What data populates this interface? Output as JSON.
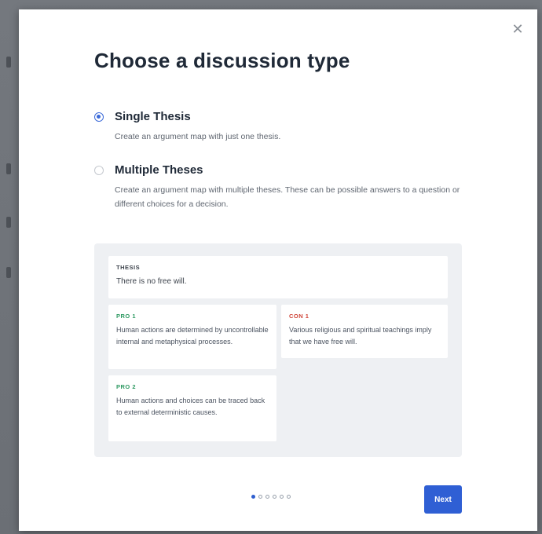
{
  "dialog": {
    "close_icon": "close-icon",
    "title": "Choose a discussion type"
  },
  "options": [
    {
      "label": "Single Thesis",
      "description": "Create an argument map with just one thesis.",
      "selected": true
    },
    {
      "label": "Multiple Theses",
      "description": "Create an argument map with multiple theses. These can be possible answers to a question or different choices for a decision.",
      "selected": false
    }
  ],
  "preview": {
    "thesis": {
      "tag": "THESIS",
      "text": "There is no free will."
    },
    "pro1": {
      "tag": "PRO 1",
      "text": "Human actions are determined by uncontrollable internal and metaphysical processes."
    },
    "con1": {
      "tag": "CON 1",
      "text": "Various religious and spiritual teachings imply that we have free will."
    },
    "pro2": {
      "tag": "PRO 2",
      "text": "Human actions and choices can be traced back to external deterministic causes."
    }
  },
  "pagination": {
    "total": 6,
    "current": 1
  },
  "footer": {
    "next_label": "Next"
  },
  "colors": {
    "accent": "#2f5fd4",
    "pro": "#2f9a63",
    "con": "#d0463a"
  }
}
